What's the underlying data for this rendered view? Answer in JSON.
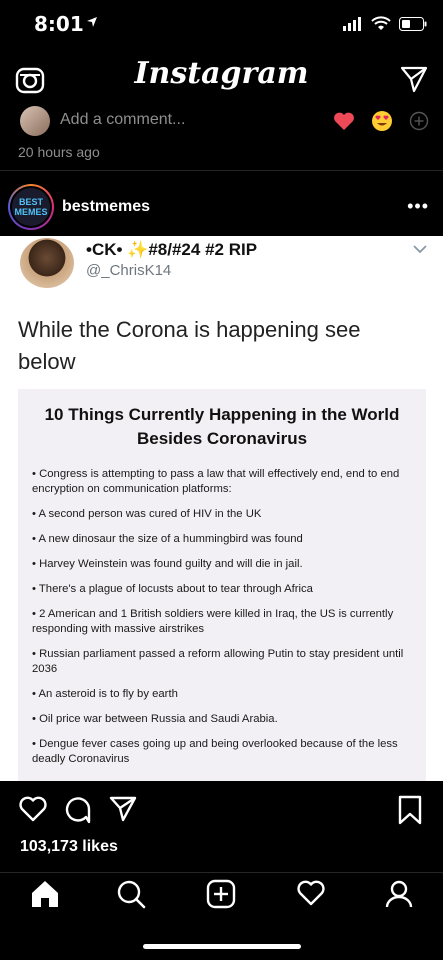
{
  "status_bar": {
    "time": "8:01"
  },
  "header": {
    "logo": "Instagram"
  },
  "comment_bar": {
    "placeholder": "Add a comment...",
    "reactions": [
      "heart-emoji",
      "heart-eyes-emoji"
    ]
  },
  "previous_post": {
    "timestamp": "20 hours ago"
  },
  "post": {
    "avatar_line1": "BEST",
    "avatar_line2": "MEMES",
    "username": "bestmemes",
    "tweet": {
      "name": "•CK• ✨#8/#24 #2 RIP",
      "handle": "@_ChrisK14",
      "text": "While the Corona is happening see below"
    },
    "card": {
      "title_line1": "10 Things Currently Happening in the World",
      "title_line2": "Besides Coronavirus",
      "items": [
        "• Congress is attempting to pass a law that will effectively end, end to end encryption on communication platforms:",
        "• A second person was cured of HIV in the UK",
        "• A new dinosaur the size of a hummingbird was found",
        "• Harvey Weinstein was found guilty and will die in jail.",
        "• There's a plague of locusts about to tear through Africa",
        "• 2 American and 1 British soldiers were killed in Iraq, the US is currently responding with massive airstrikes",
        "• Russian parliament passed a reform allowing Putin to stay president until 2036",
        "• An asteroid is to fly by earth",
        "• Oil price war between Russia and Saudi Arabia.",
        "• Dengue fever cases going up and being overlooked because of the less deadly Coronavirus"
      ]
    },
    "likes": "103,173 likes"
  },
  "colors": {
    "background": "#000000",
    "muted_text": "#8e8e8e",
    "heart_red": "#ed4956"
  }
}
